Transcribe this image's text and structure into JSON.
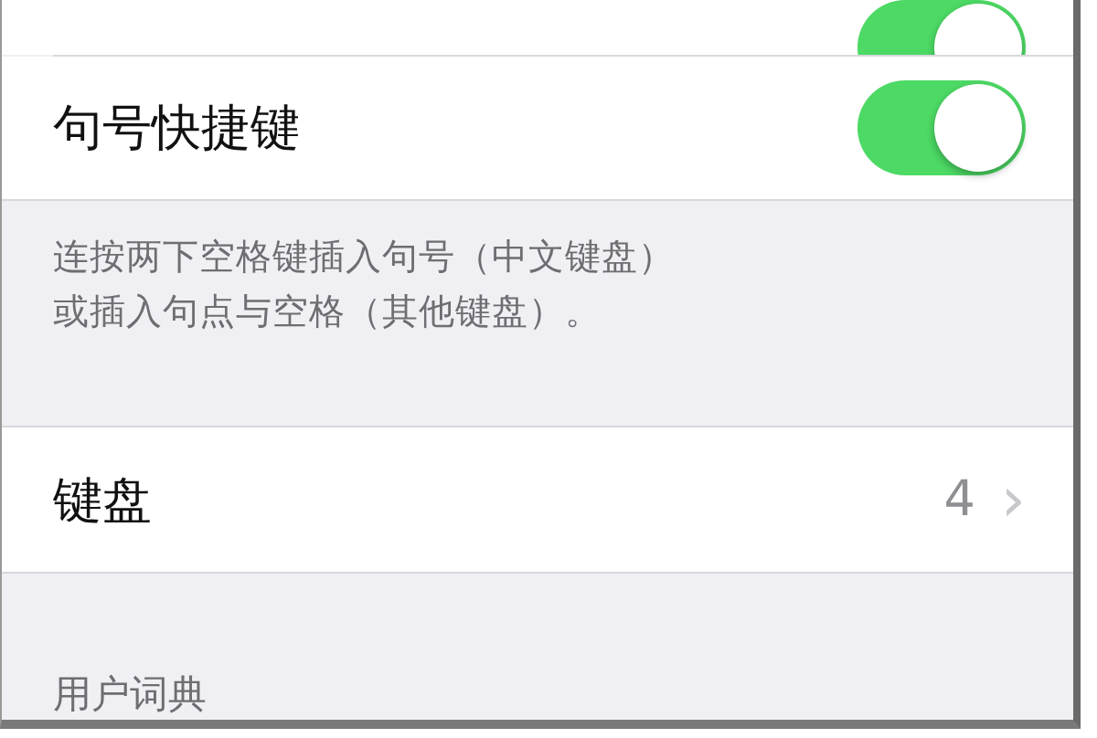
{
  "rows_top": [
    {
      "on": true
    }
  ],
  "shortcut": {
    "label": "句号快捷键",
    "on": true
  },
  "footnote": [
    "连按两下空格键插入句号（中文键盘）",
    "或插入句点与空格（其他键盘）。"
  ],
  "keyboards": {
    "label": "键盘",
    "value": "4",
    "chevron": "›"
  },
  "section_header": "用户词典"
}
